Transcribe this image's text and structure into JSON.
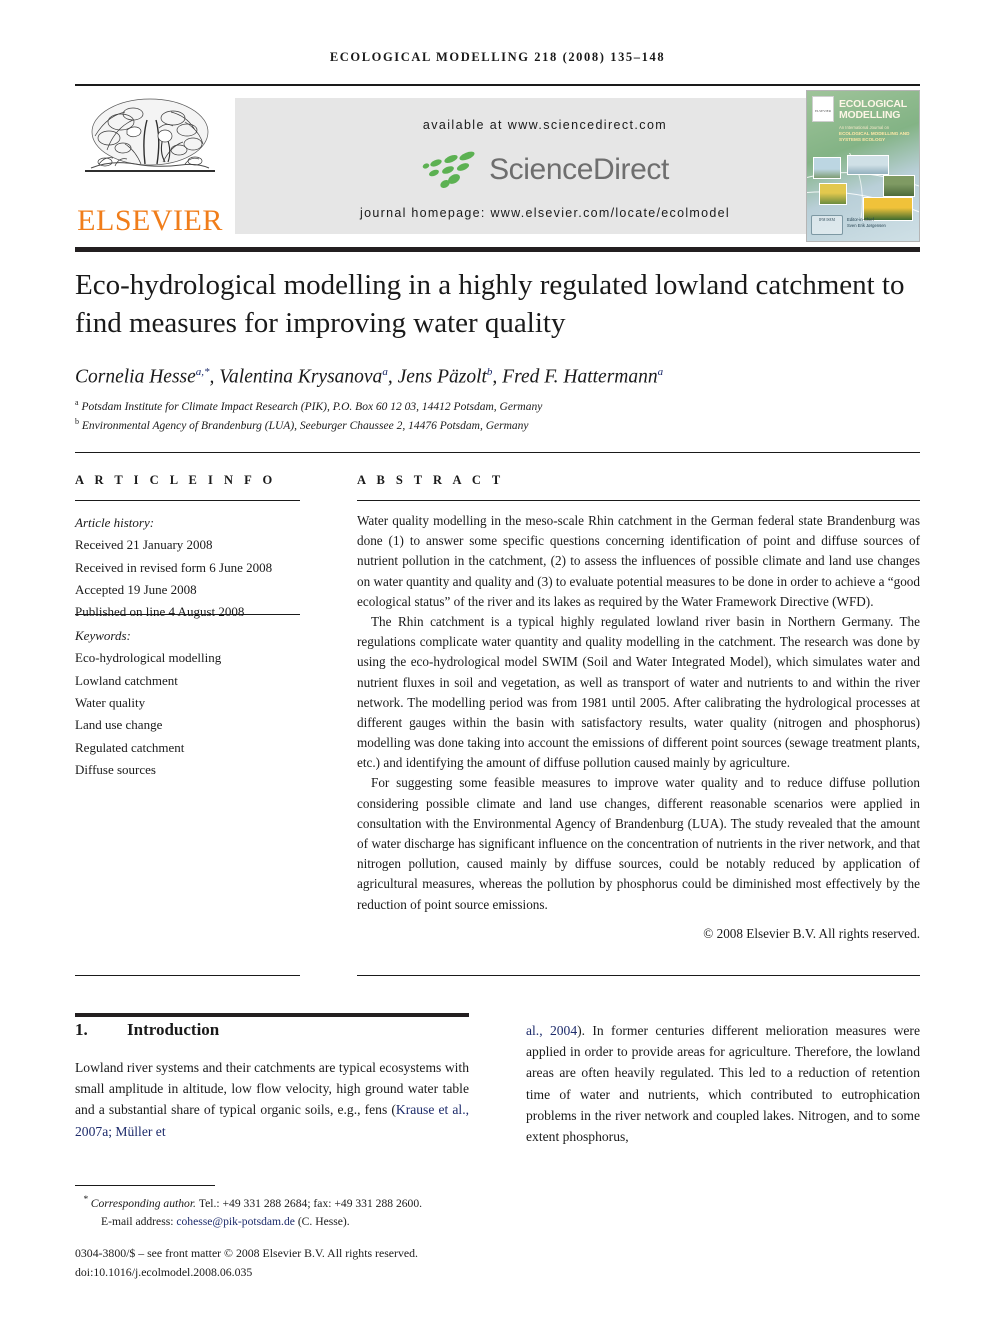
{
  "running_head": "ECOLOGICAL MODELLING 218 (2008) 135–148",
  "masthead": {
    "publisher_name": "ELSEVIER",
    "available_at": "available at www.sciencedirect.com",
    "sciencedirect_label": "ScienceDirect",
    "journal_homepage": "journal homepage: www.elsevier.com/locate/ecolmodel",
    "cover": {
      "title": "ECOLOGICAL MODELLING",
      "subtitle": "An International Journal on",
      "scope_line1": "ECOLOGICAL MODELLING AND",
      "scope_line2": "SYSTEMS ECOLOGY",
      "editor_label": "Editor-in-Chief",
      "editor_name": "Sven Erik Jørgensen",
      "society_badge": "IFM\nISEM",
      "elsevier_mark": "ELSEVIER"
    }
  },
  "article": {
    "title": "Eco-hydrological modelling in a highly regulated lowland catchment to find measures for improving water quality",
    "authors": "Cornelia Hesse, Valentina Krysanova, Jens Päzolt, Fred F. Hattermann",
    "author_list": [
      {
        "name": "Cornelia Hesse",
        "marks": "a,*"
      },
      {
        "name": "Valentina Krysanova",
        "marks": "a"
      },
      {
        "name": "Jens Päzolt",
        "marks": "b"
      },
      {
        "name": "Fred F. Hattermann",
        "marks": "a"
      }
    ],
    "affiliations": [
      {
        "mark": "a",
        "text": "Potsdam Institute for Climate Impact Research (PIK), P.O. Box 60 12 03, 14412 Potsdam, Germany"
      },
      {
        "mark": "b",
        "text": "Environmental Agency of Brandenburg (LUA), Seeburger Chaussee 2, 14476 Potsdam, Germany"
      }
    ]
  },
  "info": {
    "heading": "A R T I C L E    I N F O",
    "history_label": "Article history:",
    "history": [
      "Received 21 January 2008",
      "Received in revised form 6 June 2008",
      "Accepted 19 June 2008",
      "Published on line 4 August 2008"
    ],
    "keywords_label": "Keywords:",
    "keywords": [
      "Eco-hydrological modelling",
      "Lowland catchment",
      "Water quality",
      "Land use change",
      "Regulated catchment",
      "Diffuse sources"
    ]
  },
  "abstract": {
    "heading": "A B S T R A C T",
    "paragraphs": [
      "Water quality modelling in the meso-scale Rhin catchment in the German federal state Brandenburg was done (1) to answer some specific questions concerning identification of point and diffuse sources of nutrient pollution in the catchment, (2) to assess the influences of possible climate and land use changes on water quantity and quality and (3) to evaluate potential measures to be done in order to achieve a “good ecological status” of the river and its lakes as required by the Water Framework Directive (WFD).",
      "The Rhin catchment is a typical highly regulated lowland river basin in Northern Germany. The regulations complicate water quantity and quality modelling in the catchment. The research was done by using the eco-hydrological model SWIM (Soil and Water Integrated Model), which simulates water and nutrient fluxes in soil and vegetation, as well as transport of water and nutrients to and within the river network. The modelling period was from 1981 until 2005. After calibrating the hydrological processes at different gauges within the basin with satisfactory results, water quality (nitrogen and phosphorus) modelling was done taking into account the emissions of different point sources (sewage treatment plants, etc.) and identifying the amount of diffuse pollution caused mainly by agriculture.",
      "For suggesting some feasible measures to improve water quality and to reduce diffuse pollution considering possible climate and land use changes, different reasonable scenarios were applied in consultation with the Environmental Agency of Brandenburg (LUA). The study revealed that the amount of water discharge has significant influence on the concentration of nutrients in the river network, and that nitrogen pollution, caused mainly by diffuse sources, could be notably reduced by application of agricultural measures, whereas the pollution by phosphorus could be diminished most effectively by the reduction of point source emissions."
    ],
    "copyright": "© 2008 Elsevier B.V. All rights reserved."
  },
  "body": {
    "section_number": "1.",
    "section_title": "Introduction",
    "left_column_pre": "Lowland river systems and their catchments are typical ecosystems with small amplitude in altitude, low flow velocity, high ground water table and a substantial share of typical organic soils, e.g., fens (",
    "left_column_citation": "Krause et al., 2007a; Müller et",
    "right_column_citation": "al., 2004",
    "right_column_post": "). In former centuries different melioration measures were applied in order to provide areas for agriculture. Therefore, the lowland areas are often heavily regulated. This led to a reduction of retention time of water and nutrients, which contributed to eutrophication problems in the river network and coupled lakes. Nitrogen, and to some extent phosphorus,"
  },
  "footnote": {
    "marker": "*",
    "corresponding_label": "Corresponding author.",
    "contact": "Tel.: +49 331 288 2684; fax: +49 331 288 2600.",
    "email_label": "E-mail address:",
    "email": "cohesse@pik-potsdam.de",
    "email_owner": "(C. Hesse).",
    "front_matter": "0304-3800/$ – see front matter © 2008 Elsevier B.V. All rights reserved.",
    "doi": "doi:10.1016/j.ecolmodel.2008.06.035"
  },
  "colors": {
    "elsevier_orange": "#f07d1a",
    "sciencedirect_green": "#4caf50",
    "link_blue": "#1d2b6b",
    "banner_gray": "#e6e6e6",
    "rule_black": "#231f20"
  }
}
